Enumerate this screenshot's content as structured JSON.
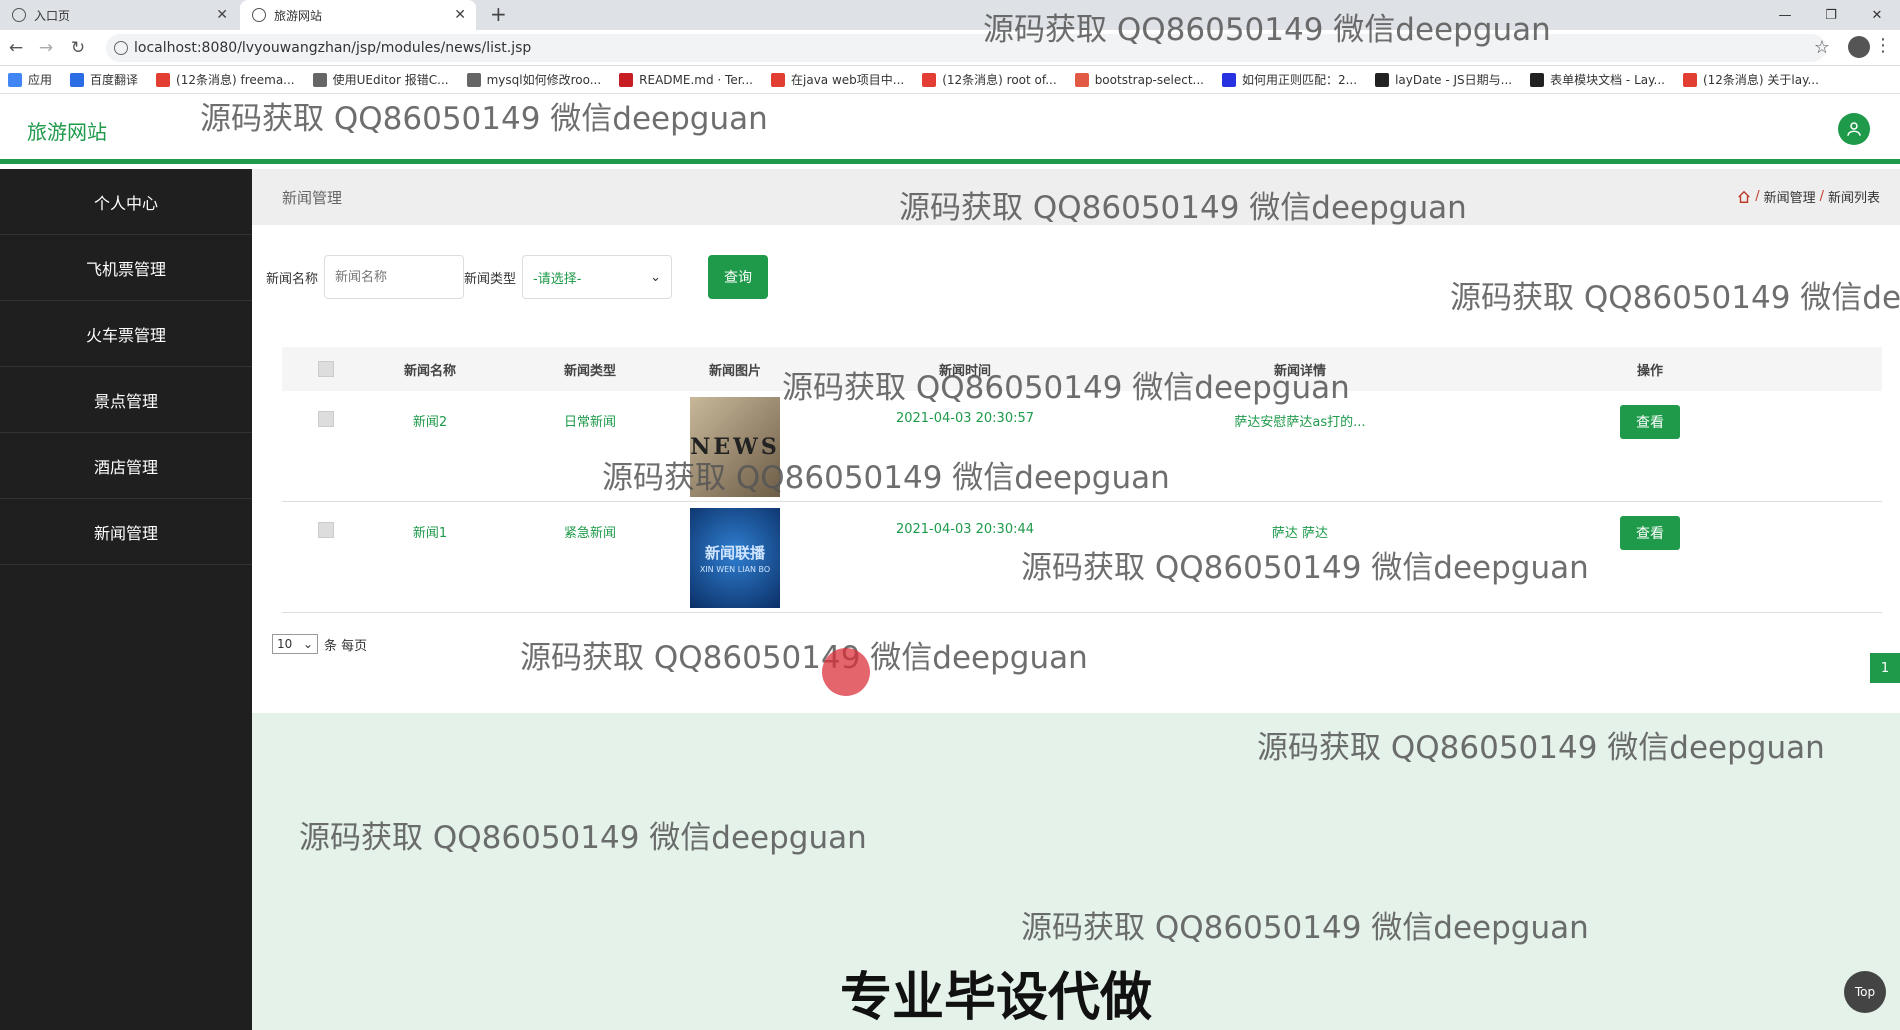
{
  "browser": {
    "tabs": [
      {
        "title": "入口页",
        "active": false
      },
      {
        "title": "旅游网站",
        "active": true
      }
    ],
    "url": "localhost:8080/lvyouwangzhan/jsp/modules/news/list.jsp",
    "bookmarks": [
      {
        "label": "应用",
        "icon": "apps-grid-icon",
        "color": "#4285f4"
      },
      {
        "label": "百度翻译",
        "icon": "baidu-translate-icon",
        "color": "#2b6de5"
      },
      {
        "label": "(12条消息) freema...",
        "icon": "csdn-icon",
        "color": "#e33e33"
      },
      {
        "label": "使用UEditor 报错C...",
        "icon": "bookmark-icon",
        "color": "#666666"
      },
      {
        "label": "mysql如何修改roo...",
        "icon": "bookmark-icon",
        "color": "#666666"
      },
      {
        "label": "README.md · Ter...",
        "icon": "gitee-icon",
        "color": "#c71d23"
      },
      {
        "label": "在java web项目中...",
        "icon": "csdn-icon",
        "color": "#e33e33"
      },
      {
        "label": "(12条消息) root of...",
        "icon": "csdn-icon",
        "color": "#e33e33"
      },
      {
        "label": "bootstrap-select...",
        "icon": "bookmark-icon",
        "color": "#e05a45"
      },
      {
        "label": "如何用正则匹配：2...",
        "icon": "baidu-icon",
        "color": "#2932e1"
      },
      {
        "label": "layDate - JS日期与...",
        "icon": "layui-icon",
        "color": "#222222"
      },
      {
        "label": "表单模块文档 - Lay...",
        "icon": "layui-icon",
        "color": "#222222"
      },
      {
        "label": "(12条消息) 关于lay...",
        "icon": "csdn-icon",
        "color": "#e33e33"
      }
    ]
  },
  "app": {
    "brand": "旅游网站",
    "accent": "#1e9a4a"
  },
  "sidebar": {
    "items": [
      {
        "label": "个人中心"
      },
      {
        "label": "飞机票管理"
      },
      {
        "label": "火车票管理"
      },
      {
        "label": "景点管理"
      },
      {
        "label": "酒店管理"
      },
      {
        "label": "新闻管理"
      }
    ]
  },
  "page": {
    "title": "新闻管理",
    "breadcrumb": [
      "新闻管理",
      "新闻列表"
    ]
  },
  "search": {
    "name_label": "新闻名称",
    "name_placeholder": "新闻名称",
    "type_label": "新闻类型",
    "type_selected": "-请选择-",
    "query_button": "查询"
  },
  "table": {
    "headers": [
      "新闻名称",
      "新闻类型",
      "新闻图片",
      "新闻时间",
      "新闻详情",
      "操作"
    ],
    "rows": [
      {
        "name": "新闻2",
        "type": "日常新闻",
        "image_text": "NEWS",
        "time": "2021-04-03 20:30:57",
        "detail": "萨达安慰萨达as打的...",
        "action": "查看"
      },
      {
        "name": "新闻1",
        "type": "紧急新闻",
        "image_text": "新闻联播",
        "image_subtext": "XIN WEN LIAN BO",
        "time": "2021-04-03 20:30:44",
        "detail": "萨达 萨达",
        "action": "查看"
      }
    ]
  },
  "pagination": {
    "page_size": "10",
    "page_size_suffix": "条 每页",
    "current_page": "1"
  },
  "overlay": {
    "watermark": "源码获取 QQ86050149 微信deepguan",
    "promo": "专业毕设代做",
    "top_button": "Top"
  }
}
